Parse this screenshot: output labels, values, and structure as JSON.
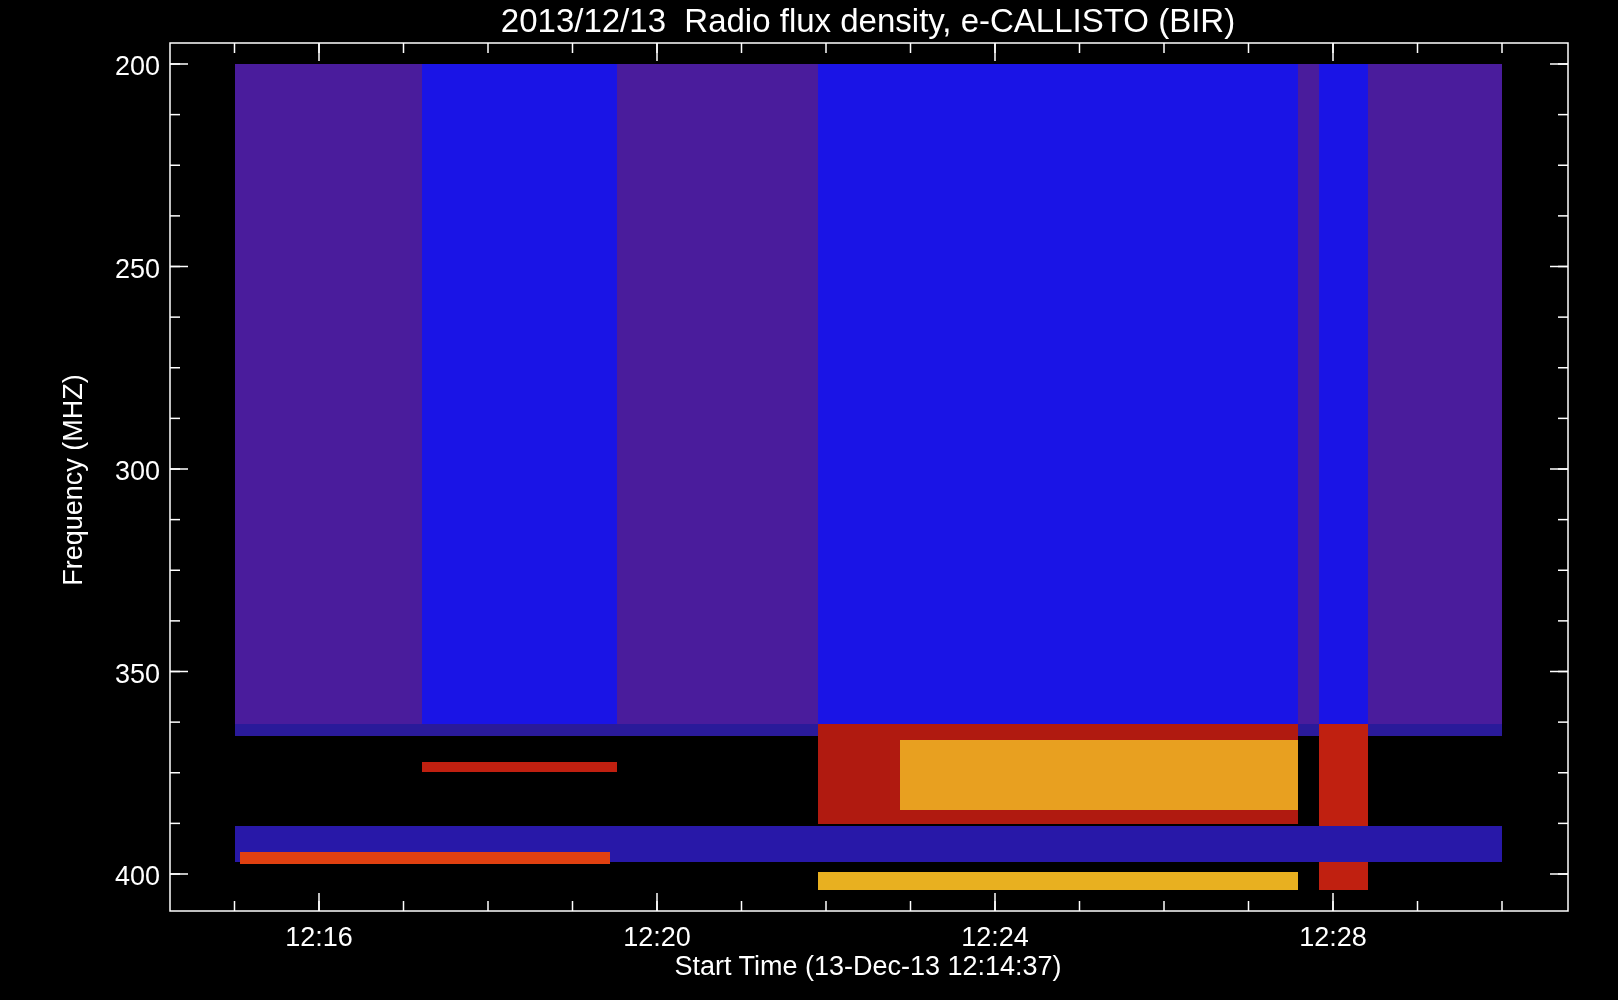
{
  "title": "2013/12/13  Radio flux density, e-CALLISTO (BIR)",
  "y_axis": {
    "label": "Frequency (MHZ)",
    "ticks": [
      "200",
      "250",
      "300",
      "350",
      "400"
    ]
  },
  "x_axis": {
    "label": "Start Time (13-Dec-13 12:14:37)",
    "ticks": [
      "12:16",
      "12:20",
      "12:24",
      "12:28"
    ]
  }
}
